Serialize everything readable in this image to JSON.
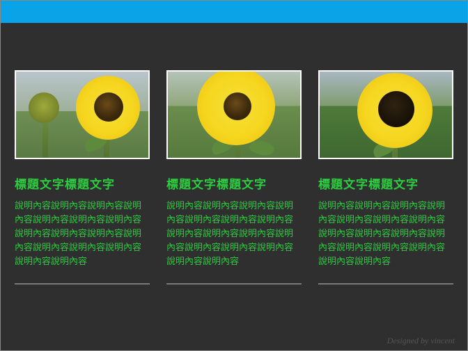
{
  "cards": [
    {
      "title": "標題文字標題文字",
      "body": "說明內容說明內容說明內容說明內容說明內容說明內容說明內容說明內容說明內容說明內容說明內容說明內容說明內容說明內容說明內容說明內容"
    },
    {
      "title": "標題文字標題文字",
      "body": "說明內容說明內容說明內容說明內容說明內容說明內容說明內容說明內容說明內容說明內容說明內容說明內容說明內容說明內容說明內容說明內容"
    },
    {
      "title": "標題文字標題文字",
      "body": "說明內容說明內容說明內容說明內容說明內容說明內容說明內容說明內容說明內容說明內容說明內容說明內容說明內容說明內容說明內容說明內容"
    }
  ],
  "credit": "Designed by vincent"
}
